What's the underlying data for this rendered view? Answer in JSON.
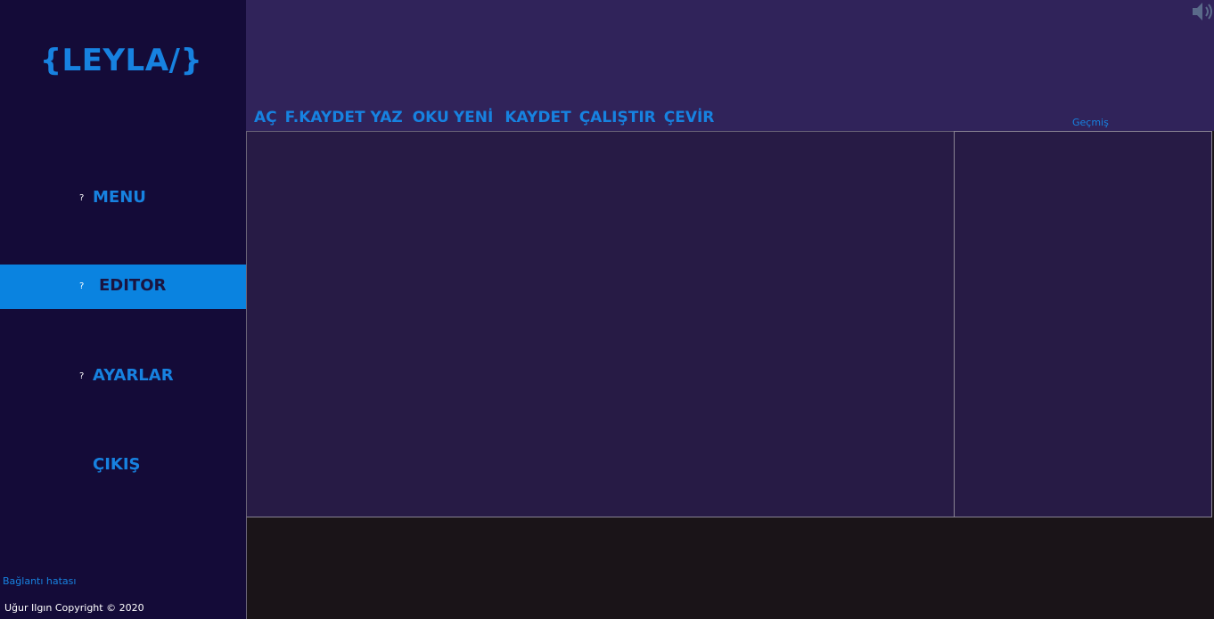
{
  "app": {
    "logo": "{LEYLA/}"
  },
  "sidebar": {
    "items": [
      {
        "icon_glyph": "?",
        "label": "MENU",
        "active": false
      },
      {
        "icon_glyph": "?",
        "label": "EDITOR",
        "active": true
      },
      {
        "icon_glyph": "?",
        "label": "AYARLAR",
        "active": false
      },
      {
        "icon_glyph": "",
        "label": "ÇIKIŞ",
        "active": false
      }
    ],
    "status": "Bağlantı hatası",
    "copyright": "Uğur Ilgın Copyright © 2020"
  },
  "toolbar": {
    "buttons": [
      "AÇ",
      "F.KAYDET",
      "YAZ",
      "OKU",
      "YENİ",
      "KAYDET",
      "ÇALIŞTIR",
      "ÇEVİR"
    ]
  },
  "history": {
    "label": "Geçmiş"
  },
  "editor": {
    "content": ""
  },
  "output": {
    "content": ""
  },
  "colors": {
    "accent": "#1782e0",
    "active_bg": "#0a83e0",
    "sidebar_bg": "#140b38",
    "header_bg": "#30235a",
    "editor_bg": "#271b45",
    "output_bg": "#1a1418"
  },
  "icons": {
    "speaker": "speaker-icon"
  }
}
